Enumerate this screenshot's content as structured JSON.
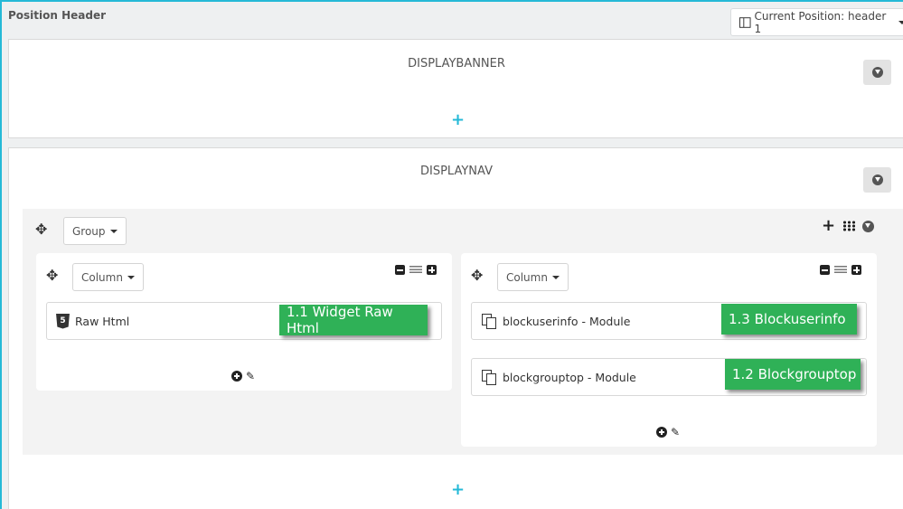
{
  "header": {
    "title": "Position Header",
    "position_button": "Current Position: header 1"
  },
  "hooks": [
    {
      "name": "DISPLAYBANNER"
    },
    {
      "name": "DISPLAYNAV"
    }
  ],
  "group": {
    "label": "Group",
    "columns": [
      {
        "label": "Column",
        "widgets": [
          {
            "name": "Raw Html",
            "tag": "1.1 Widget Raw Html",
            "icon": "html5-icon"
          }
        ]
      },
      {
        "label": "Column",
        "widgets": [
          {
            "name": "blockuserinfo - Module",
            "tag": "1.3 Blockuserinfo",
            "icon": "module-icon"
          },
          {
            "name": "blockgrouptop - Module",
            "tag": "1.2 Blockgrouptop",
            "icon": "module-icon"
          }
        ]
      }
    ]
  },
  "colors": {
    "accent": "#25b9d7",
    "tag": "#2fb157"
  }
}
